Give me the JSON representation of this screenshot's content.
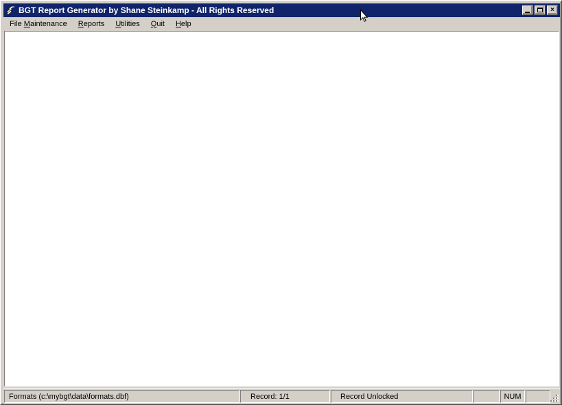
{
  "window": {
    "title": "BGT Report Generator by Shane Steinkamp - All Rights Reserved",
    "icon_name": "app-arrows-icon",
    "titlebar_color": "#10246b",
    "face_color": "#d4d0c8",
    "client_color": "#ffffff",
    "controls": {
      "minimize_label": "Minimize",
      "maximize_label": "Maximize",
      "close_label": "Close",
      "close_glyph": "×"
    }
  },
  "menu": {
    "items": [
      {
        "label": "File Maintenance",
        "pre": "File ",
        "accel": "M",
        "post": "aintenance"
      },
      {
        "label": "Reports",
        "pre": "",
        "accel": "R",
        "post": "eports"
      },
      {
        "label": "Utilities",
        "pre": "",
        "accel": "U",
        "post": "tilities"
      },
      {
        "label": "Quit",
        "pre": "",
        "accel": "Q",
        "post": "uit"
      },
      {
        "label": "Help",
        "pre": "",
        "accel": "H",
        "post": "elp"
      }
    ]
  },
  "client": {
    "content": ""
  },
  "status_bar": {
    "file_info": "Formats (c:\\mybgt\\data\\formats.dbf)",
    "record": "Record: 1/1",
    "lock_state": "Record Unlocked",
    "indicator_1": "",
    "indicator_num": "NUM",
    "indicator_2": ""
  }
}
